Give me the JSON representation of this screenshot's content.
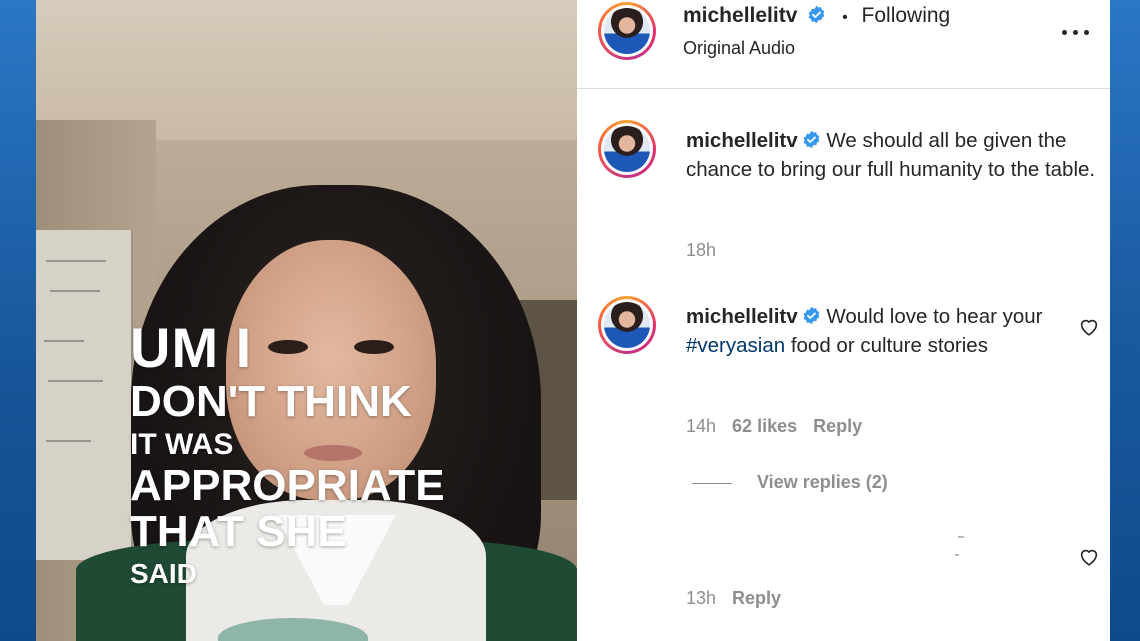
{
  "video": {
    "caption_lines": [
      "UM I",
      "DON'T THINK",
      "IT WAS",
      "APPROPRIATE",
      "THAT SHE",
      "SAID"
    ]
  },
  "post_header": {
    "username": "michellelitv",
    "follow_status": "Following",
    "audio": "Original Audio",
    "verified": true,
    "icons": {
      "more": "more-options-icon",
      "verified": "verified-badge-icon"
    }
  },
  "caption": {
    "username": "michellelitv",
    "text": "We should all be given the chance to bring our full humanity to the table.",
    "time": "18h"
  },
  "comments": [
    {
      "username": "michellelitv",
      "text_before": "Would love to hear your ",
      "hashtag": "#veryasian",
      "text_after": " food or culture stories",
      "time": "14h",
      "likes": "62 likes",
      "reply": "Reply",
      "view_replies": "View replies (2)"
    },
    {
      "time": "13h",
      "reply": "Reply"
    }
  ],
  "colors": {
    "text": "#262626",
    "muted": "#8e8e8e",
    "hashtag": "#00376b",
    "verified": "#3897f0",
    "frame": "#1f66b3"
  }
}
